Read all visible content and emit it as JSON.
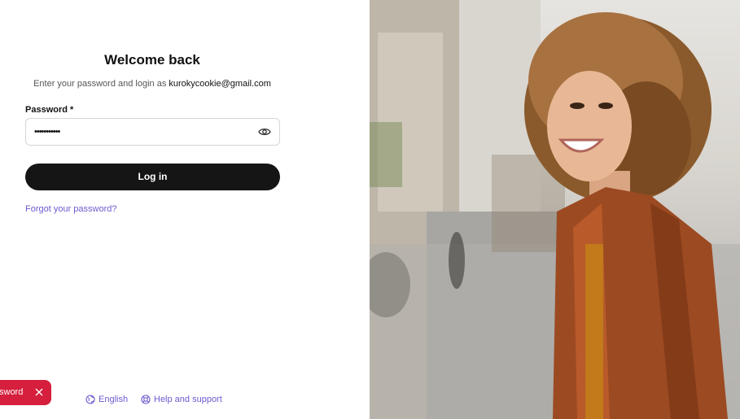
{
  "login": {
    "title": "Welcome back",
    "subtitle_prefix": "Enter your password and login as",
    "email": "kurokycookie@gmail.com",
    "password_label": "Password *",
    "password_value": "•••••••••••",
    "show_password_icon": "eye-icon",
    "login_button": "Log in",
    "forgot_link": "Forgot your password?"
  },
  "toast": {
    "text": "sword",
    "close_icon": "close-icon",
    "color": "#d51f3c"
  },
  "footer": {
    "language": "English",
    "language_icon": "globe-icon",
    "help": "Help and support",
    "help_icon": "lifebuoy-icon"
  },
  "colors": {
    "accent": "#6b5bd1",
    "button_bg": "#151515"
  }
}
